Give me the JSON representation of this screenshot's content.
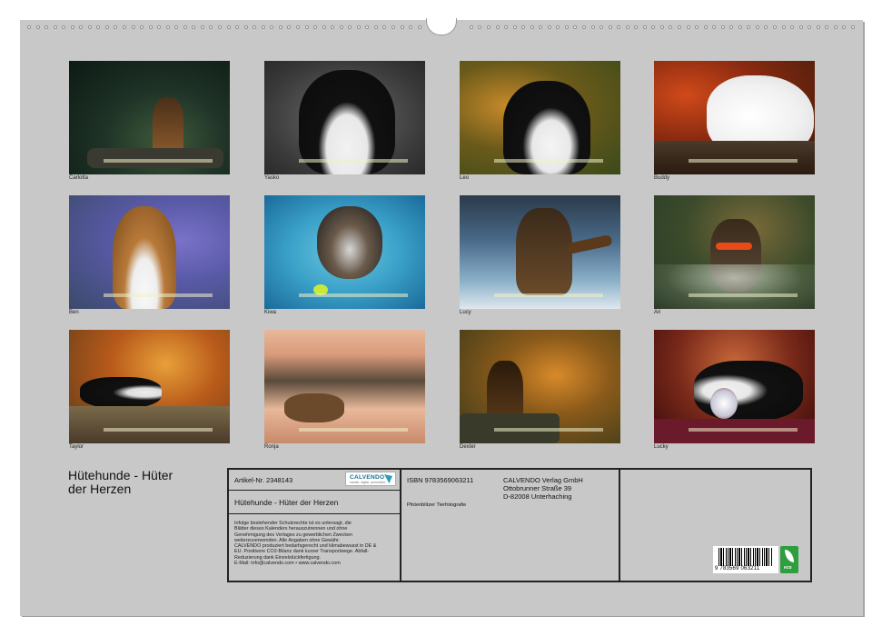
{
  "photos": [
    {
      "caption": "Carlotta"
    },
    {
      "caption": "Yasko"
    },
    {
      "caption": "Leo"
    },
    {
      "caption": "Buddy"
    },
    {
      "caption": "Ben"
    },
    {
      "caption": "Kiwa"
    },
    {
      "caption": "Lucy"
    },
    {
      "caption": "Ari"
    },
    {
      "caption": "Taylor"
    },
    {
      "caption": "Ronja"
    },
    {
      "caption": "Dexter"
    },
    {
      "caption": "Lucky"
    }
  ],
  "title": {
    "line1": "Hütehunde - Hüter",
    "line2": "der Herzen"
  },
  "info": {
    "article": "Artikel-Nr. 2348143",
    "subtitle": "Hütehunde - Hüter der Herzen",
    "legal": [
      "Infolge bestehender Schutzrechte ist es untersagt, die",
      "Blätter dieses Kalenders herauszutrennen und ohne",
      "Genehmigung des Verlages zu gewerblichen Zwecken",
      "weiterzuverwenden. Alle Angaben ohne Gewähr.",
      "CALVENDO produziert bedarfsgerecht und klimabewusst in DE &",
      "EU. Positivere CO2-Bilanz dank kurzer Transportwege. Abfall-",
      "Reduzierung dank Einzelstückfertigung.",
      "E-Mail: info@calvendo.com • www.calvendo.com"
    ],
    "isbn": "ISBN 9783569063211",
    "author": "Pfotenblitzer Tierfotografie",
    "publisher": [
      "CALVENDO Verlag GmbH",
      "Ottobrunner Straße 39",
      "D-82008 Unterhaching"
    ],
    "logo_text": "CALVENDO",
    "logo_sub": "kreativ. digital. persönlich.",
    "barcode_number": "9 783569 063211",
    "eco_label": "eco"
  }
}
